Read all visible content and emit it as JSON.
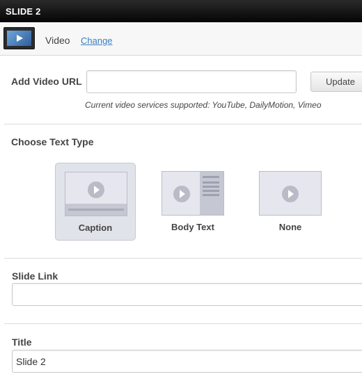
{
  "panel": {
    "title": "SLIDE 2"
  },
  "media": {
    "type_label": "Video",
    "change_label": "Change"
  },
  "video_url": {
    "label": "Add Video URL",
    "value": "",
    "update_label": "Update",
    "support_note": "Current video services supported: YouTube, DailyMotion, Vimeo"
  },
  "text_type": {
    "label": "Choose Text Type",
    "options": [
      {
        "label": "Caption",
        "selected": true
      },
      {
        "label": "Body Text",
        "selected": false
      },
      {
        "label": "None",
        "selected": false
      }
    ]
  },
  "slide_link": {
    "label": "Slide Link",
    "value": ""
  },
  "title_field": {
    "label": "Title",
    "value": "Slide 2"
  },
  "colors": {
    "link": "#3a7fc1",
    "selected_bg": "#e1e3ea",
    "titlebar": "#0a0a0a"
  }
}
